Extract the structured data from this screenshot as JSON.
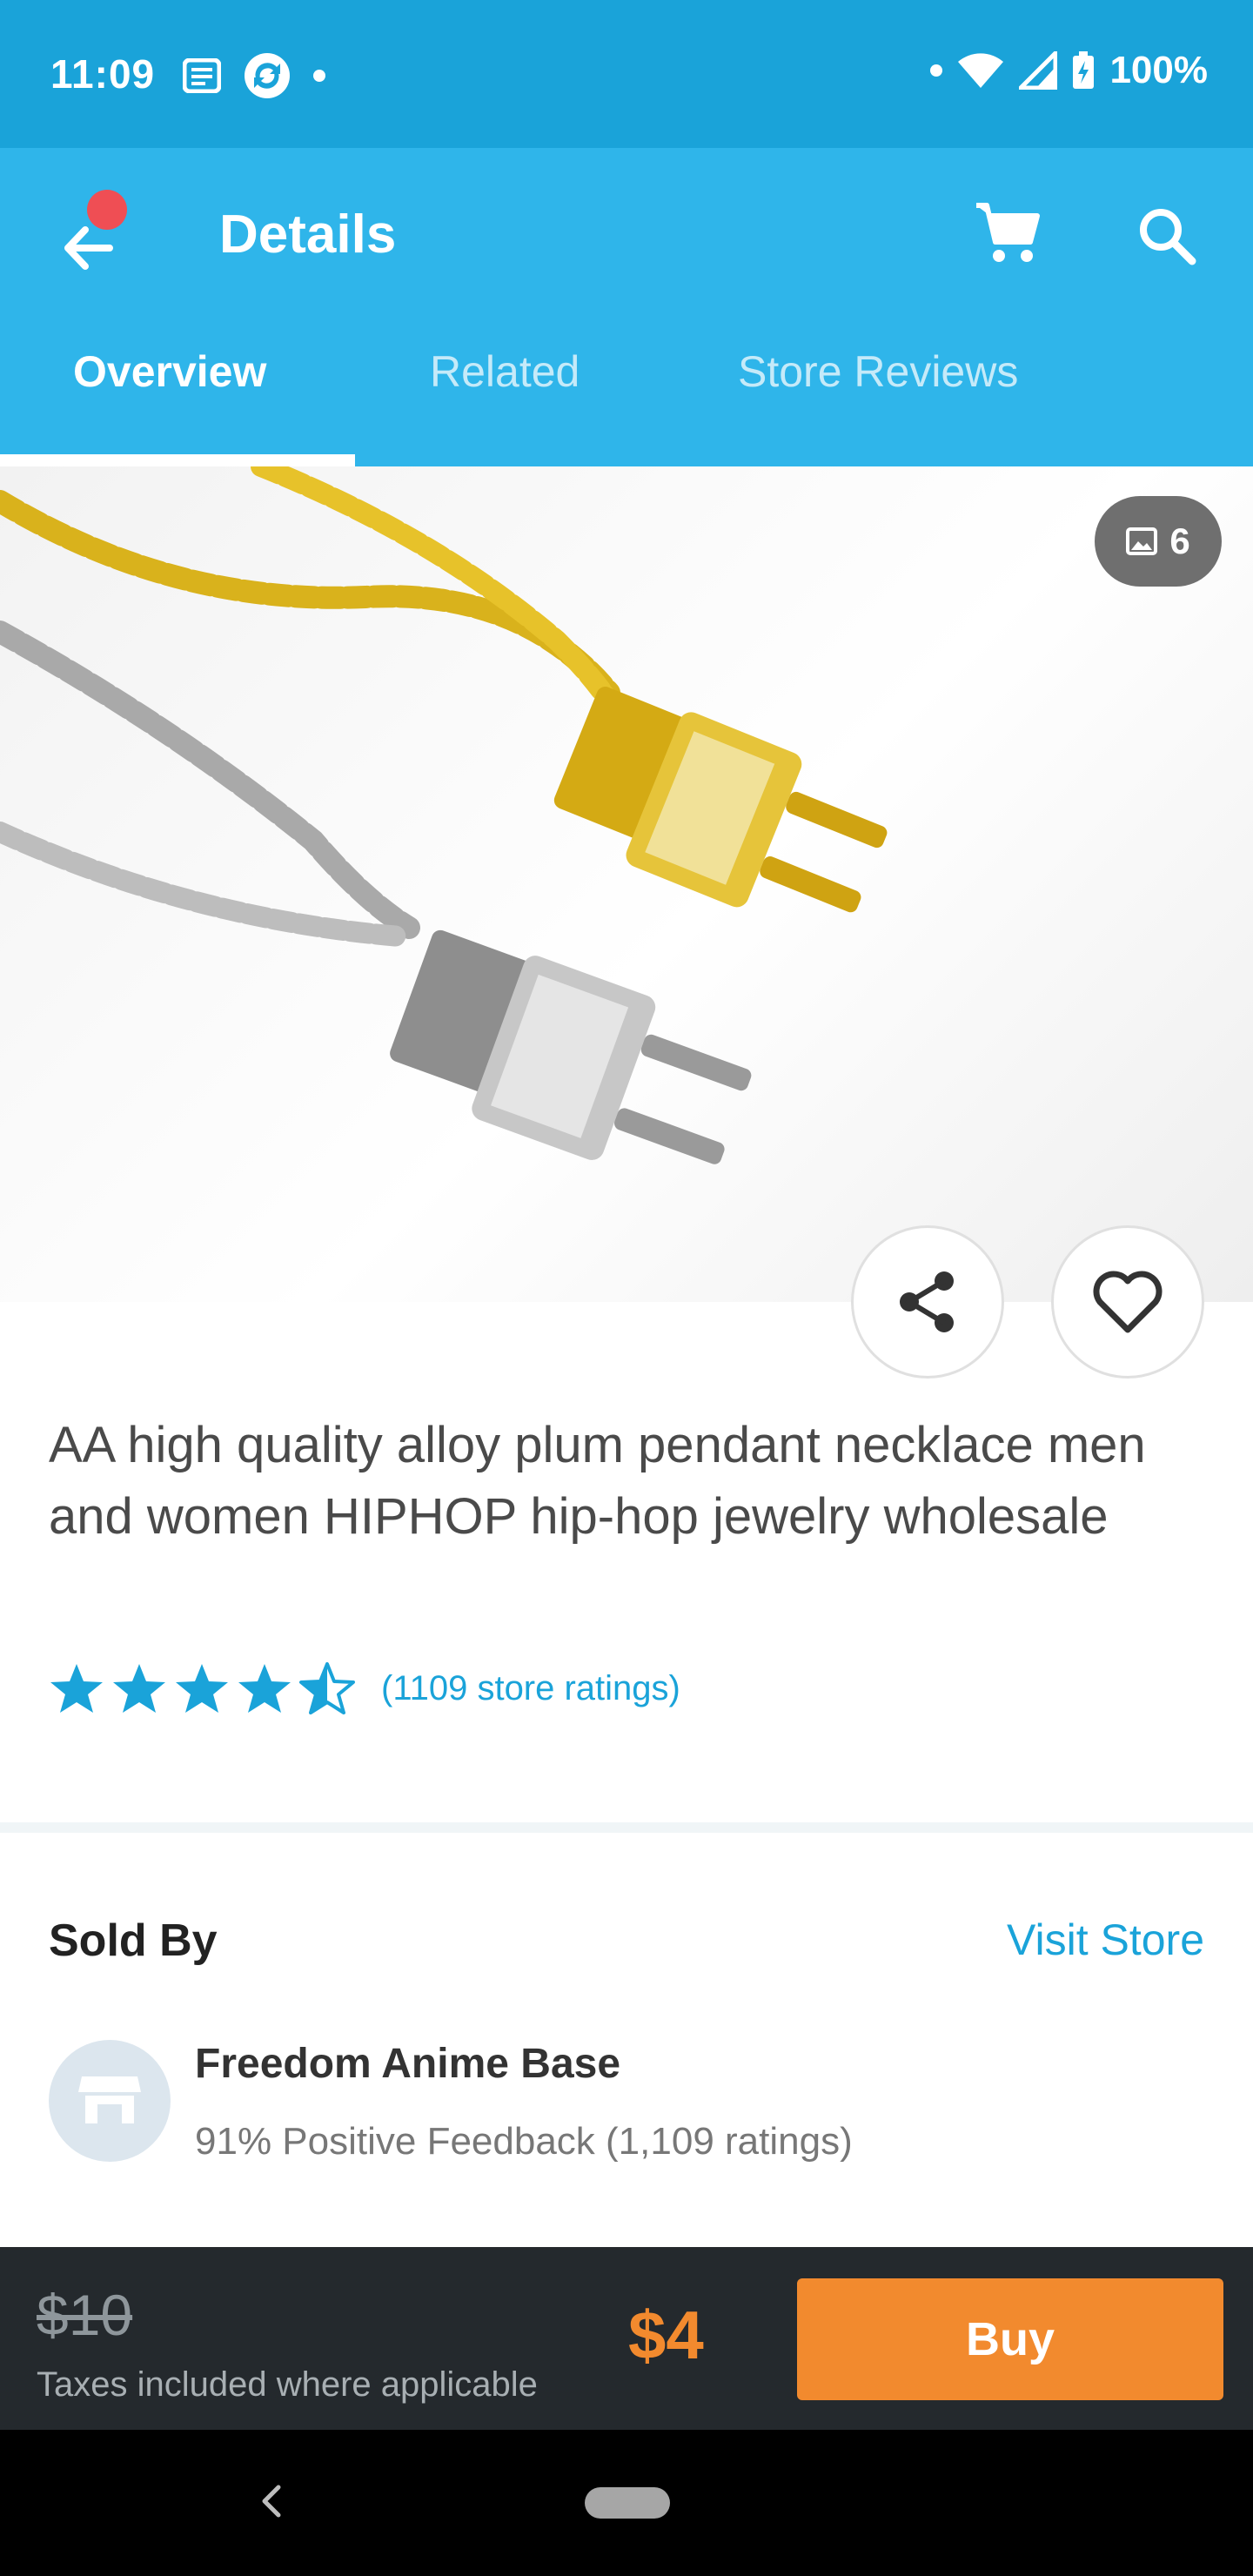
{
  "status_bar": {
    "time": "11:09",
    "battery": "100%"
  },
  "app_bar": {
    "title": "Details"
  },
  "tabs": [
    {
      "label": "Overview",
      "active": true
    },
    {
      "label": "Related",
      "active": false
    },
    {
      "label": "Store Reviews",
      "active": false
    }
  ],
  "hero": {
    "photo_count": "6"
  },
  "product": {
    "title": "AA high quality alloy plum pendant necklace men and women HIPHOP hip-hop jewelry wholesale",
    "rating": 4.5,
    "rating_text": "(1109 store ratings)"
  },
  "seller": {
    "section_label": "Sold By",
    "visit_store": "Visit Store",
    "name": "Freedom Anime Base",
    "feedback": "91% Positive Feedback (1,109 ratings)"
  },
  "purchase": {
    "old_price": "$10",
    "tax_note": "Taxes included where applicable",
    "price": "$4",
    "buy_label": "Buy"
  },
  "colors": {
    "status_bar": "#1aa3d9",
    "app_bar": "#2fb5ea",
    "accent": "#f28a2e",
    "link": "#1aa3d9"
  }
}
